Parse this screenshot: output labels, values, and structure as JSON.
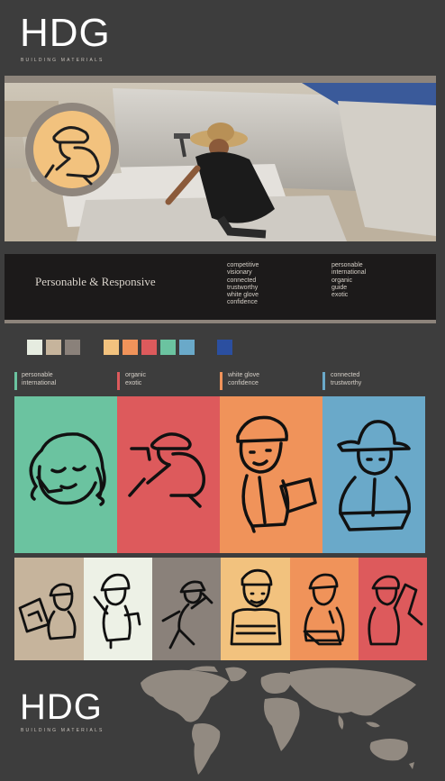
{
  "brand": {
    "name": "HDG",
    "tagline": "BUILDING MATERIALS"
  },
  "hero": {
    "headline": "Personable & Responsive",
    "words_col1": [
      "competitive",
      "visionary",
      "connected",
      "trustworthy",
      "white glove",
      "confidence"
    ],
    "words_col2": [
      "personable",
      "international",
      "organic",
      "guide",
      "exotic"
    ]
  },
  "palette": {
    "neutrals": [
      "#e6ece0",
      "#c6b49c",
      "#8a817a"
    ],
    "accents": [
      "#f2c27e",
      "#f0935a",
      "#dd5a5c",
      "#6bc3a0",
      "#6aa9c9"
    ],
    "blue": "#2b4fa0"
  },
  "legend": [
    {
      "color": "#6bc3a0",
      "line1": "personable",
      "line2": "international"
    },
    {
      "color": "#dd5a5c",
      "line1": "organic",
      "line2": "exotic"
    },
    {
      "color": "#f0935a",
      "line1": "white glove",
      "line2": "confidence"
    },
    {
      "color": "#6aa9c9",
      "line1": "connected",
      "line2": "trustworthy"
    }
  ],
  "panels_large": [
    {
      "color": "#6bc3a0",
      "icon": "woman-headset-icon"
    },
    {
      "color": "#dd5a5c",
      "icon": "stone-carver-icon"
    },
    {
      "color": "#f0935a",
      "icon": "worker-clipboard-icon"
    },
    {
      "color": "#6aa9c9",
      "icon": "man-hat-icon"
    }
  ],
  "panels_small": [
    {
      "color": "#c6b49c",
      "icon": "worker-tablet-icon"
    },
    {
      "color": "#edf1e6",
      "icon": "worker-pointing-icon"
    },
    {
      "color": "#8a817a",
      "icon": "worker-hammer-icon"
    },
    {
      "color": "#f2c27e",
      "icon": "worker-arms-crossed-icon"
    },
    {
      "color": "#f0935a",
      "icon": "worker-laptop-icon"
    },
    {
      "color": "#dd5a5c",
      "icon": "worker-carrying-icon"
    }
  ],
  "map": {
    "icon": "world-map-icon"
  }
}
